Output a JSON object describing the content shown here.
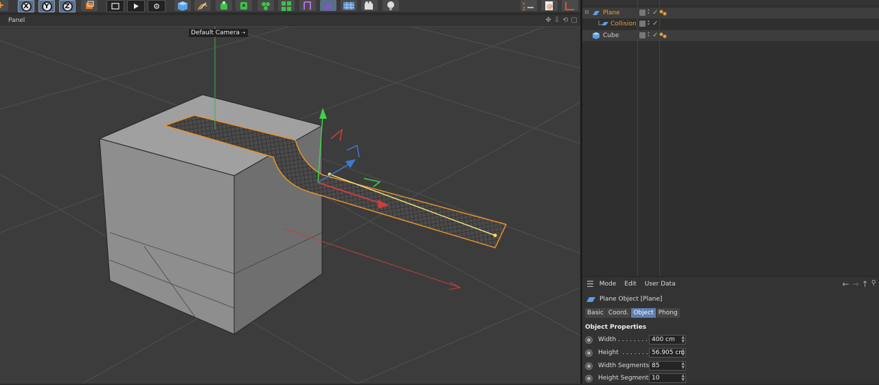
{
  "viewport": {
    "panel_label": "Panel",
    "camera_label": "Default Camera",
    "camera_icon": "camera-dot-icon"
  },
  "toolbar": {
    "axis_buttons": [
      "X",
      "Y",
      "Z"
    ]
  },
  "object_manager": {
    "objects": [
      {
        "name": "Plane",
        "icon": "plane-icon",
        "color": "#e8a23a",
        "indent": 0,
        "selected": true
      },
      {
        "name": "Collision",
        "icon": "collision-tag-icon",
        "color": "#e8a23a",
        "indent": 1,
        "selected": false
      },
      {
        "name": "Cube",
        "icon": "cube-icon",
        "color": "#cfcfcf",
        "indent": 0,
        "selected": true
      }
    ]
  },
  "attribute_manager": {
    "menu": [
      "Mode",
      "Edit",
      "User Data"
    ],
    "title": "Plane Object [Plane]",
    "tabs": [
      "Basic",
      "Coord.",
      "Object",
      "Phong"
    ],
    "active_tab": "Object",
    "section": "Object Properties",
    "properties": [
      {
        "label": "Width . . . . . . . .",
        "value": "400 cm"
      },
      {
        "label": "Height  . . . . . . .",
        "value": "56.905 cm"
      },
      {
        "label": "Width Segments",
        "value": "85"
      },
      {
        "label": "Height Segments",
        "value": "10"
      }
    ]
  },
  "colors": {
    "accent_orange": "#e8a23a",
    "selection_blue": "#5d7fb0",
    "axis_x": "#d23c3c",
    "axis_y": "#3cd24b",
    "axis_z": "#3c7ad2"
  }
}
